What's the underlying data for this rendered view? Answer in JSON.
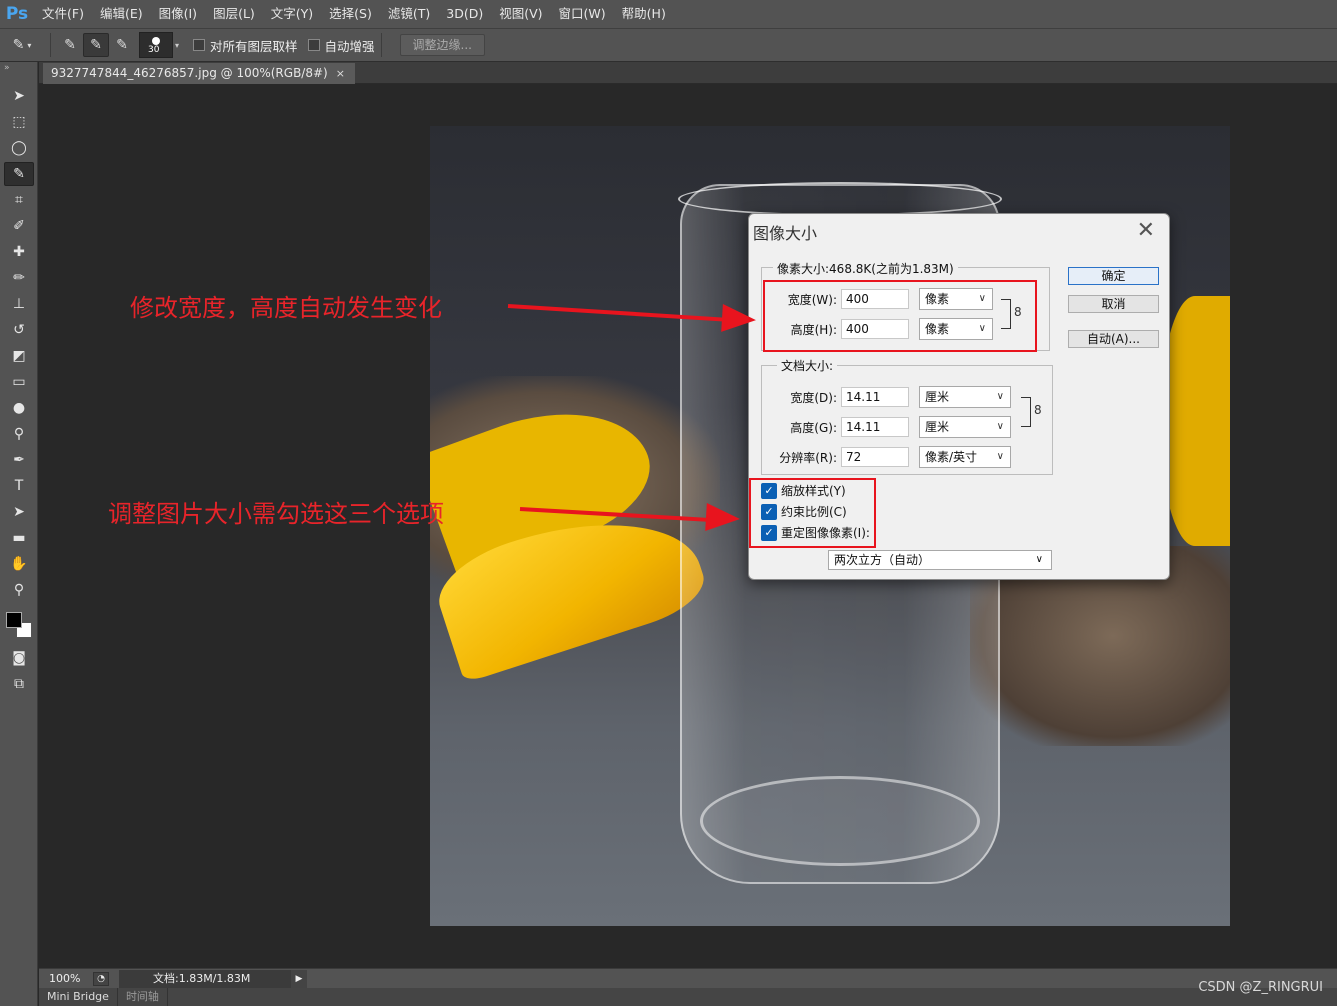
{
  "app": {
    "logo": "Ps"
  },
  "menu": [
    "文件(F)",
    "编辑(E)",
    "图像(I)",
    "图层(L)",
    "文字(Y)",
    "选择(S)",
    "滤镜(T)",
    "3D(D)",
    "视图(V)",
    "窗口(W)",
    "帮助(H)"
  ],
  "options": {
    "brush_size": "30",
    "sample_all_layers": "对所有图层取样",
    "auto_enhance": "自动增强",
    "refine_edge": "调整边缘..."
  },
  "document": {
    "tab_title": "9327747844_46276857.jpg @ 100%(RGB/8#)",
    "close": "×"
  },
  "dialog": {
    "title": "图像大小",
    "close": "✕",
    "pixel_dims_legend": "像素大小:468.8K(之前为1.83M)",
    "width_label": "宽度(W):",
    "width_value": "400",
    "width_unit": "像素",
    "height_label": "高度(H):",
    "height_value": "400",
    "height_unit": "像素",
    "doc_size_legend": "文档大小:",
    "doc_width_label": "宽度(D):",
    "doc_width_value": "14.11",
    "doc_width_unit": "厘米",
    "doc_height_label": "高度(G):",
    "doc_height_value": "14.11",
    "doc_height_unit": "厘米",
    "resolution_label": "分辨率(R):",
    "resolution_value": "72",
    "resolution_unit": "像素/英寸",
    "ok": "确定",
    "cancel": "取消",
    "auto": "自动(A)...",
    "scale_styles": "缩放样式(Y)",
    "constrain": "约束比例(C)",
    "resample": "重定图像像素(I):",
    "resample_method": "两次立方（自动）"
  },
  "annotations": {
    "note1": "修改宽度，高度自动发生变化",
    "note2": "调整图片大小需勾选这三个选项",
    "accent_color": "#e8141e"
  },
  "status": {
    "zoom": "100%",
    "doc_size": "文档:1.83M/1.83M"
  },
  "bottom_tabs": [
    "Mini Bridge",
    "时间轴"
  ],
  "watermark": "CSDN @Z_RINGRUI"
}
